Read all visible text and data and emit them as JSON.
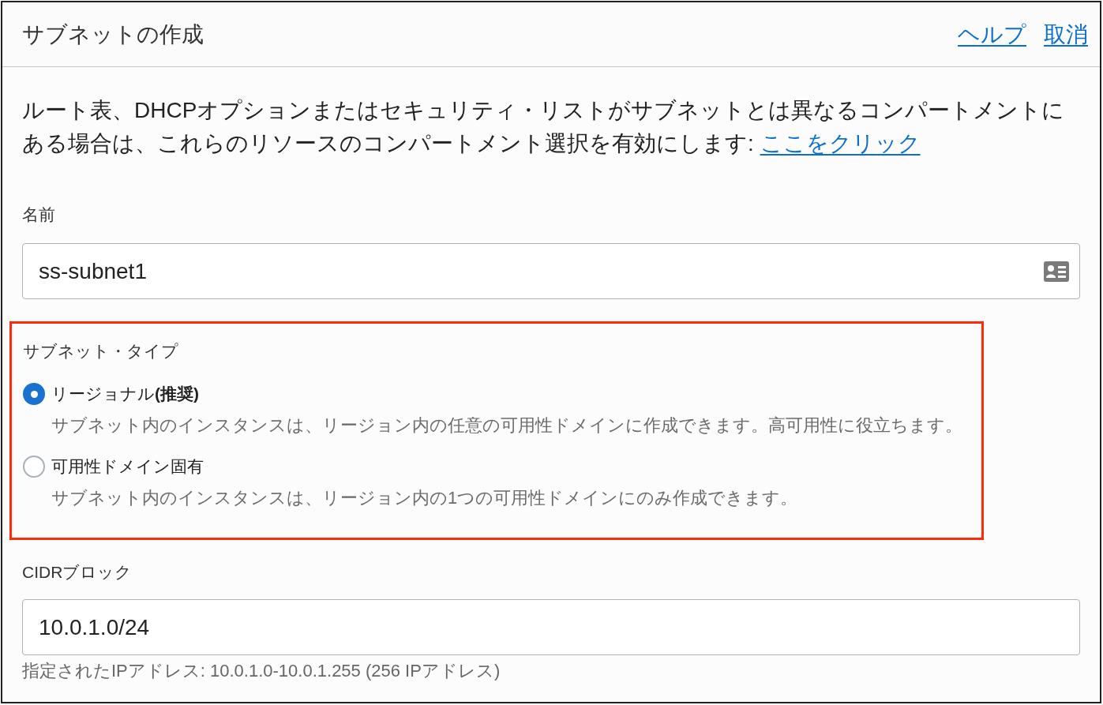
{
  "dialog": {
    "title": "サブネットの作成",
    "header_links": [
      "ヘルプ",
      "取消"
    ]
  },
  "intro": {
    "text": "ルート表、DHCPオプションまたはセキュリティ・リストがサブネットとは異なるコンパートメントにある場合は、これらのリソースのコンパートメント選択を有効にします: ",
    "link": "ここをクリック"
  },
  "name_field": {
    "label": "名前",
    "value": "ss-subnet1"
  },
  "subnet_type": {
    "label": "サブネット・タイプ",
    "highlighted": true,
    "options": [
      {
        "label": "リージョナル**(推奨)**",
        "description": "サブネット内のインスタンスは、リージョン内の任意の可用性ドメインに作成できます。高可用性に役立ちます。",
        "selected": true
      },
      {
        "label": "可用性ドメイン固有",
        "description": "サブネット内のインスタンスは、リージョン内の1つの可用性ドメインにのみ作成できます。",
        "selected": false
      }
    ]
  },
  "cidr_field": {
    "label": "CIDRブロック",
    "value": "10.0.1.0/24",
    "hint": "指定されたIPアドレス: 10.0.1.0-10.0.1.255 (256 IPアドレス)"
  }
}
